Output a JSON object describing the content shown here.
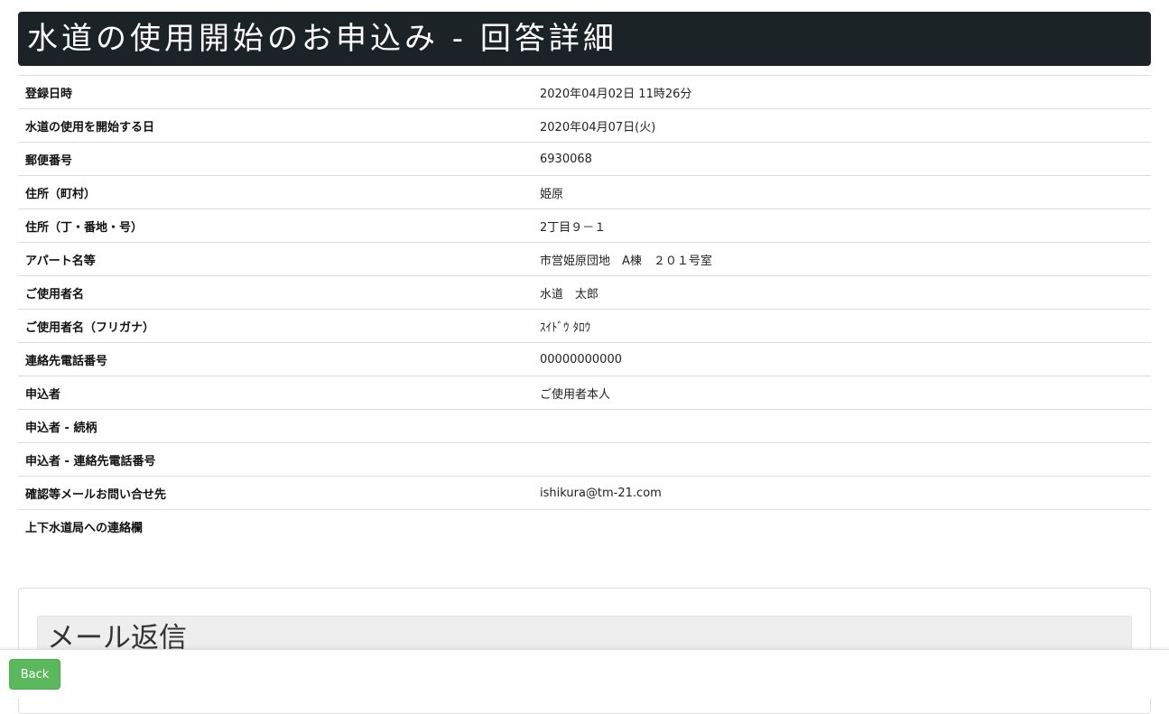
{
  "header": {
    "title": "水道の使用開始のお申込み - 回答詳細",
    "background_color": "#1c2326"
  },
  "details": {
    "rows": [
      {
        "label": "登録日時",
        "value": "2020年04月02日 11時26分"
      },
      {
        "label": "水道の使用を開始する日",
        "value": "2020年04月07日(火)"
      },
      {
        "label": "郵便番号",
        "value": "6930068"
      },
      {
        "label": "住所（町村）",
        "value": "姫原"
      },
      {
        "label": "住所（丁・番地・号）",
        "value": "2丁目９－１"
      },
      {
        "label": "アパート名等",
        "value": "市営姫原団地　A棟　２０１号室"
      },
      {
        "label": "ご使用者名",
        "value": "水道　太郎"
      },
      {
        "label": "ご使用者名（フリガナ）",
        "value": "ｽｲﾄﾞｳ ﾀﾛｳ"
      },
      {
        "label": "連絡先電話番号",
        "value": "00000000000"
      },
      {
        "label": "申込者",
        "value": "ご使用者本人"
      },
      {
        "label": "申込者 - 続柄",
        "value": ""
      },
      {
        "label": "申込者 - 連絡先電話番号",
        "value": ""
      },
      {
        "label": "確認等メールお問い合せ先",
        "value": "ishikura@tm-21.com"
      },
      {
        "label": "上下水道局への連絡欄",
        "value": ""
      }
    ]
  },
  "reply": {
    "heading": "メール返信"
  },
  "footer": {
    "back_label": "Back",
    "button_color": "#5cb85c"
  }
}
